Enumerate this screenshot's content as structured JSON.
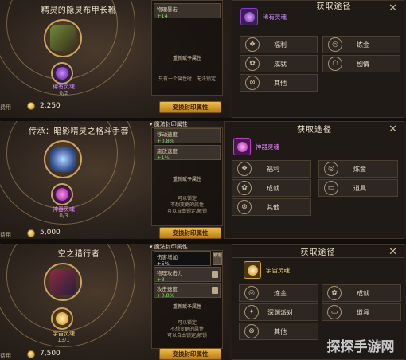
{
  "panels": [
    {
      "title": "精灵的隐灵布甲长靴",
      "attr_head": "",
      "stats": [
        {
          "name": "物理暴击",
          "value": "+14"
        }
      ],
      "reroll_label": "重新赋予属性",
      "note_lines": [
        "只有一个属性时，无法锁定"
      ],
      "soul_name": "稀有灵魂",
      "soul_count": "0/2",
      "cost_label": "费用",
      "cost_value": "2,250",
      "swap_label": "变换封印属性",
      "source": {
        "title": "获取途径",
        "head_item_name": "稀有灵魂",
        "sources": [
          "福利",
          "炼金",
          "成就",
          "剧情",
          "其他"
        ]
      }
    },
    {
      "title": "传承：暗影精灵之格斗手套",
      "attr_head": "魔法封印属性",
      "stats": [
        {
          "name": "移动速度",
          "value": "+0.8%"
        },
        {
          "name": "施放速度",
          "value": "+1%"
        }
      ],
      "reroll_label": "重新赋予属性",
      "note_lines": [
        "可以锁定",
        "不想变更的属性",
        "可以自由锁定/解锁"
      ],
      "soul_name": "神器灵魂",
      "soul_count": "0/3",
      "cost_label": "费用",
      "cost_value": "5,000",
      "swap_label": "变换封印属性",
      "source": {
        "title": "获取途径",
        "head_item_name": "神器灵魂",
        "sources": [
          "福利",
          "炼金",
          "成就",
          "道具",
          "其他"
        ]
      }
    },
    {
      "title": "空之猎行者",
      "attr_head": "魔法封印属性",
      "stats": [
        {
          "name": "伤害增加",
          "value": "+5%"
        },
        {
          "name": "物理攻击力",
          "value": "+8"
        },
        {
          "name": "攻击速度",
          "value": "+0.8%"
        }
      ],
      "reroll_label": "重新赋予属性",
      "note_lines": [
        "可以锁定",
        "不想变更的属性",
        "可以自由锁定/解锁"
      ],
      "soul_name": "宇宙灵魂",
      "soul_count": "13/1",
      "cost_label": "费用",
      "cost_value": "7,500",
      "swap_label": "变换封印属性",
      "source": {
        "title": "获取途径",
        "head_item_name": "宇宙灵魂",
        "sources": [
          "炼金",
          "成就",
          "深渊派对",
          "道具",
          "其他"
        ]
      }
    }
  ],
  "lock_label": "锁定",
  "watermark": "探探手游网",
  "colors": {
    "accent_gold": "#f0c04a",
    "stat_green": "#7fd66a",
    "rare_purple": "#8a3cc9",
    "legend_magenta": "#c23bd1",
    "epic_gold": "#d6a232"
  }
}
